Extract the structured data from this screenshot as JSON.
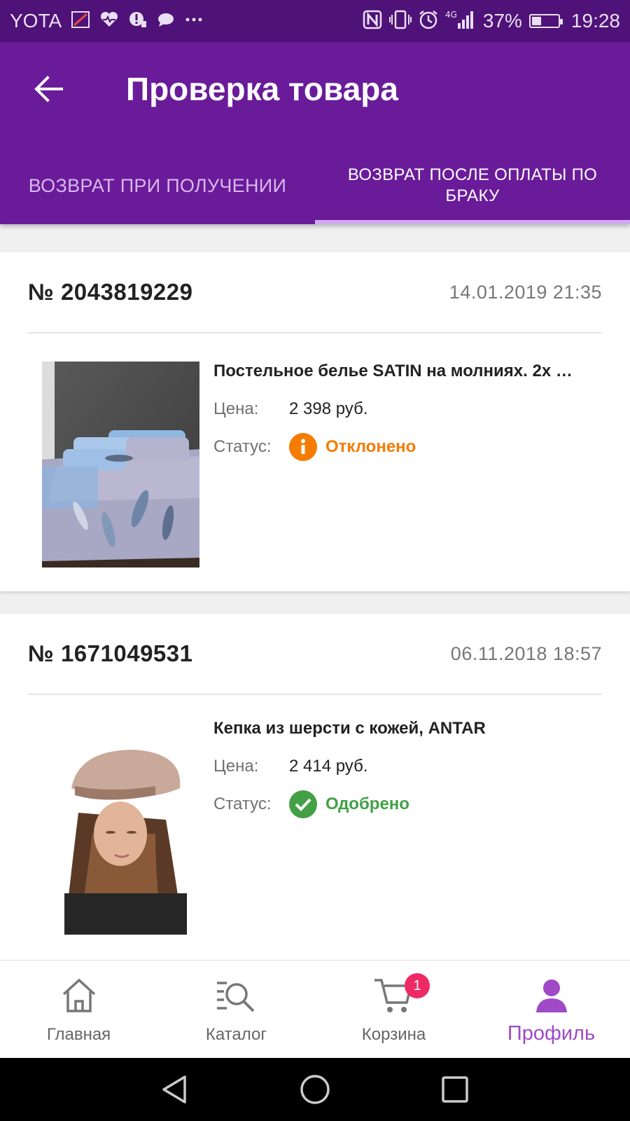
{
  "status_bar": {
    "carrier": "YOTA",
    "battery_percent": "37%",
    "battery_level": 0.37,
    "time": "19:28",
    "network": "4G",
    "icons": [
      "carrier-logo-icon",
      "health-heart-icon",
      "notification-icon",
      "chat-bubble-icon",
      "more-dots-icon",
      "nfc-icon",
      "vibrate-icon",
      "alarm-icon",
      "signal-icon",
      "battery-icon"
    ]
  },
  "header": {
    "title": "Проверка товара",
    "back_icon": "arrow-left-icon"
  },
  "tabs": [
    {
      "label": "ВОЗВРАТ ПРИ ПОЛУЧЕНИИ",
      "active": false
    },
    {
      "label": "ВОЗВРАТ ПОСЛЕ ОПЛАТЫ ПО БРАКУ",
      "active": true
    }
  ],
  "orders": [
    {
      "number": "№ 2043819229",
      "date": "14.01.2019 21:35",
      "product": {
        "title": "Постельное белье SATIN на молниях. 2х …",
        "price_label": "Цена:",
        "price": "2 398 руб.",
        "status_label": "Статус:",
        "status": "Отклонено",
        "status_icon": "info-circle-icon",
        "status_color": "#f57c00",
        "image": "bedding-image"
      }
    },
    {
      "number": "№ 1671049531",
      "date": "06.11.2018 18:57",
      "product": {
        "title": "Кепка из шерсти с кожей, ANTAR",
        "price_label": "Цена:",
        "price": "2 414 руб.",
        "status_label": "Статус:",
        "status": "Одобрено",
        "status_icon": "check-circle-icon",
        "status_color": "#43a047",
        "image": "cap-woman-image"
      }
    }
  ],
  "bottom_nav": [
    {
      "label": "Главная",
      "icon": "home-icon",
      "active": false
    },
    {
      "label": "Каталог",
      "icon": "catalog-search-icon",
      "active": false
    },
    {
      "label": "Корзина",
      "icon": "cart-icon",
      "active": false,
      "badge": "1"
    },
    {
      "label": "Профиль",
      "icon": "profile-icon",
      "active": true
    }
  ],
  "system_nav": [
    "back-triangle-icon",
    "home-circle-icon",
    "recents-square-icon"
  ],
  "colors": {
    "primary": "#6a1b9a",
    "status_bar": "#4f1278",
    "accent": "#a04ac7",
    "badge": "#ee2a64"
  }
}
